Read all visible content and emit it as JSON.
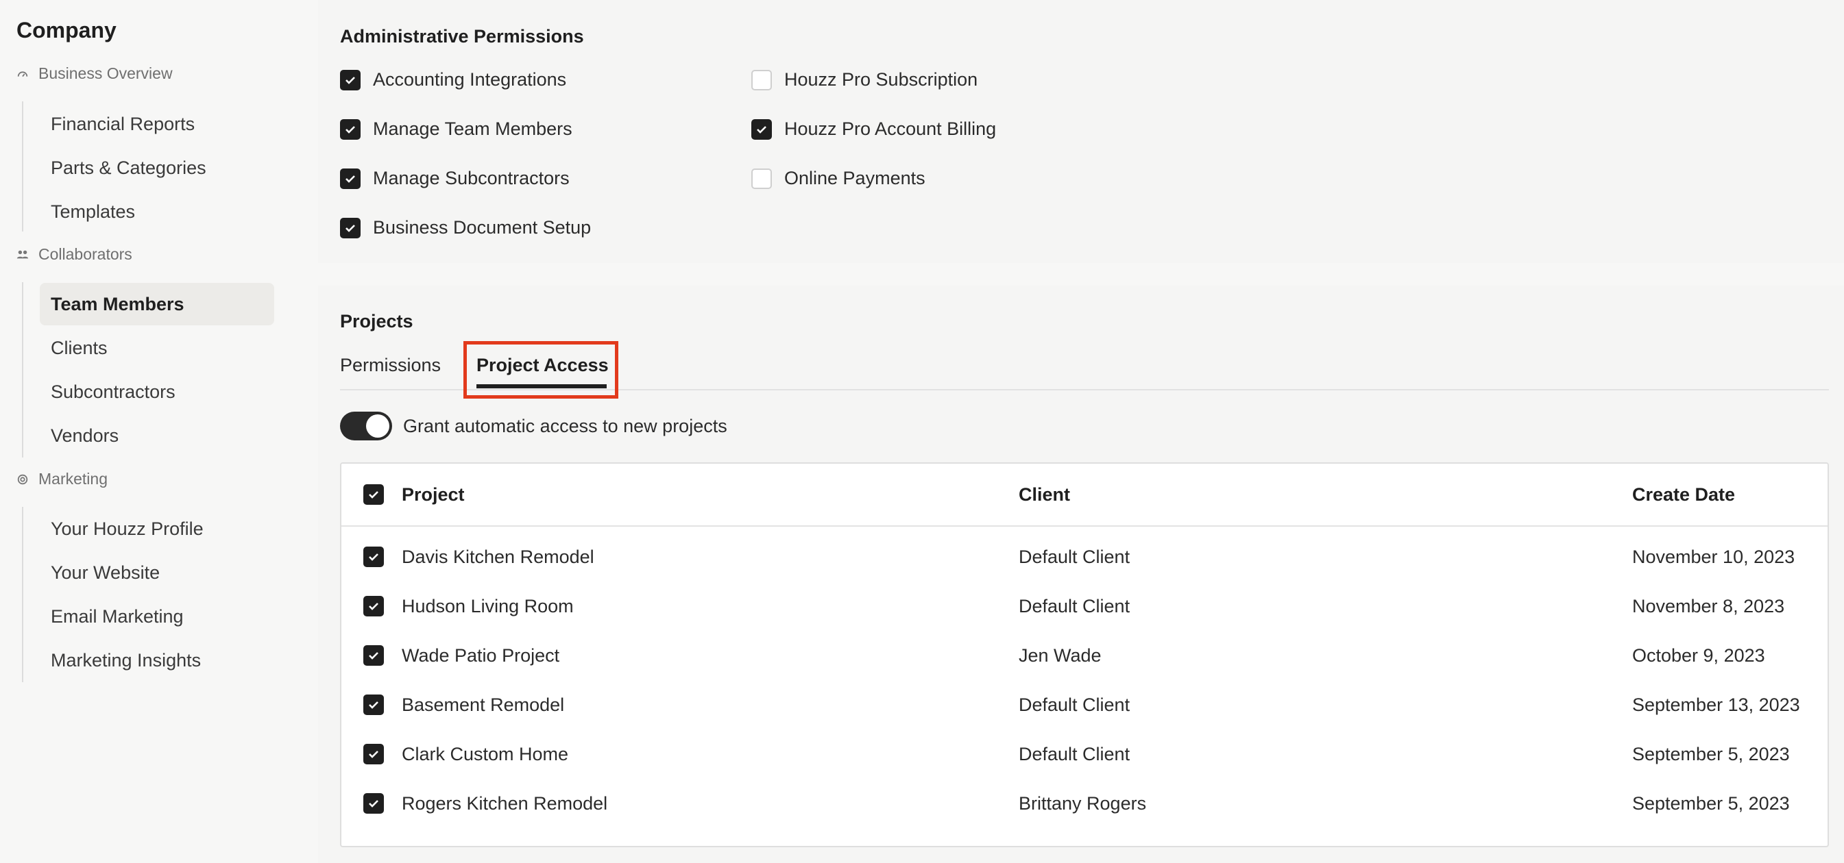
{
  "sidebar": {
    "company": "Company",
    "sections": [
      {
        "label": "Business Overview",
        "icon": "gauge-icon"
      },
      {
        "label": "Collaborators",
        "icon": "people-icon"
      },
      {
        "label": "Marketing",
        "icon": "at-icon"
      }
    ],
    "items": [
      {
        "label": "Financial Reports"
      },
      {
        "label": "Parts & Categories"
      },
      {
        "label": "Templates"
      },
      {
        "label": "Team Members",
        "active": true
      },
      {
        "label": "Clients"
      },
      {
        "label": "Subcontractors"
      },
      {
        "label": "Vendors"
      },
      {
        "label": "Your Houzz Profile"
      },
      {
        "label": "Your Website"
      },
      {
        "label": "Email Marketing"
      },
      {
        "label": "Marketing Insights"
      }
    ]
  },
  "admin": {
    "title": "Administrative Permissions",
    "permissions": [
      {
        "label": "Accounting Integrations",
        "checked": true
      },
      {
        "label": "Manage Team Members",
        "checked": true
      },
      {
        "label": "Manage Subcontractors",
        "checked": true
      },
      {
        "label": "Business Document Setup",
        "checked": true
      },
      {
        "label": "Houzz Pro Subscription",
        "checked": false
      },
      {
        "label": "Houzz Pro Account Billing",
        "checked": true
      },
      {
        "label": "Online Payments",
        "checked": false
      }
    ]
  },
  "projects": {
    "title": "Projects",
    "tabs": [
      {
        "label": "Permissions",
        "active": false
      },
      {
        "label": "Project Access",
        "active": true
      }
    ],
    "toggle_label": "Grant automatic access to new projects",
    "toggle_on": true,
    "table": {
      "headers": {
        "project": "Project",
        "client": "Client",
        "date": "Create Date"
      },
      "rows": [
        {
          "project": "Davis Kitchen Remodel",
          "client": "Default Client",
          "date": "November 10, 2023",
          "checked": true
        },
        {
          "project": "Hudson Living Room",
          "client": "Default Client",
          "date": "November 8, 2023",
          "checked": true
        },
        {
          "project": "Wade Patio Project",
          "client": "Jen Wade",
          "date": "October 9, 2023",
          "checked": true
        },
        {
          "project": "Basement Remodel",
          "client": "Default Client",
          "date": "September 13, 2023",
          "checked": true
        },
        {
          "project": "Clark Custom Home",
          "client": "Default Client",
          "date": "September 5, 2023",
          "checked": true
        },
        {
          "project": "Rogers Kitchen Remodel",
          "client": "Brittany Rogers",
          "date": "September 5, 2023",
          "checked": true
        }
      ]
    }
  },
  "colors": {
    "accent": "#1f1f1f",
    "highlight": "#e23a1c"
  }
}
